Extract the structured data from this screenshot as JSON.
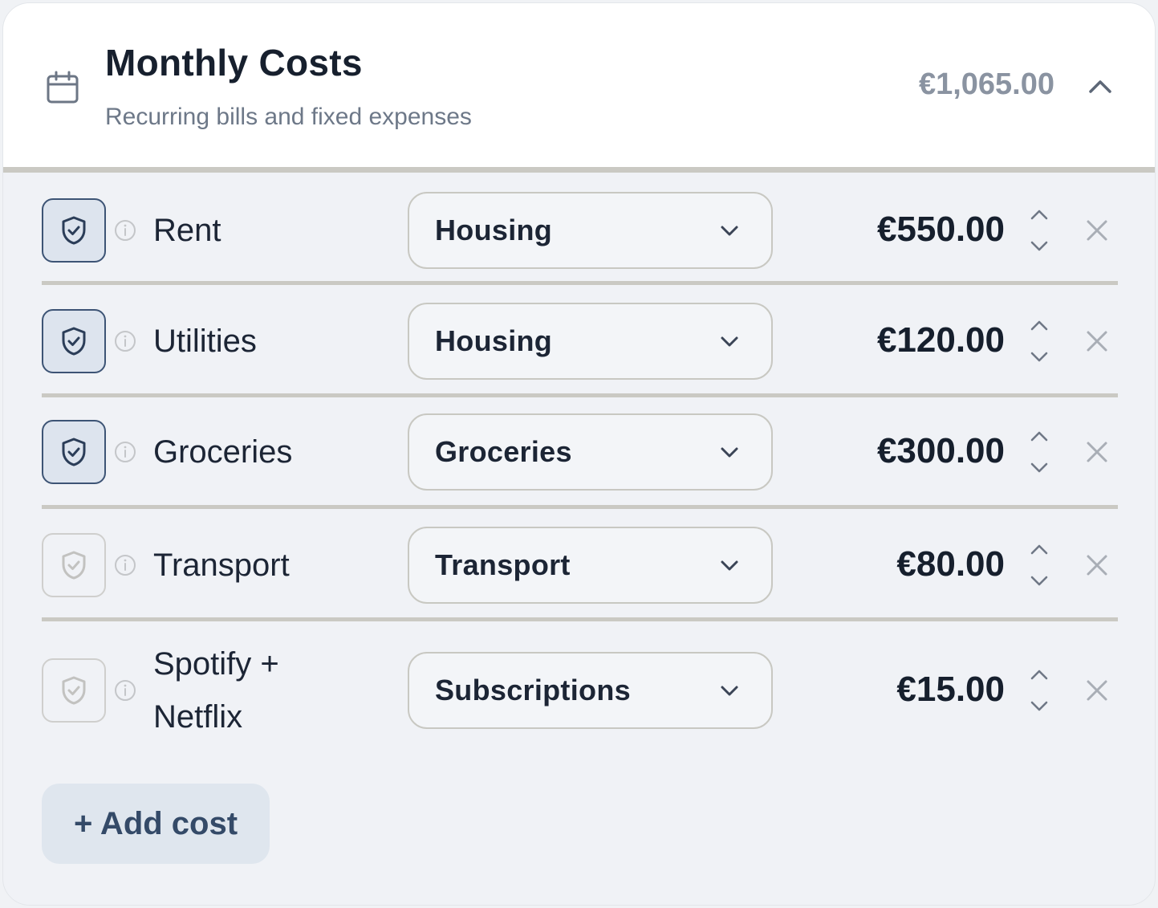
{
  "header": {
    "title": "Monthly Costs",
    "subtitle": "Recurring bills and fixed expenses",
    "total": "€1,065.00"
  },
  "items": [
    {
      "name": "Rent",
      "category": "Housing",
      "amount": "€550.00",
      "protected": true
    },
    {
      "name": "Utilities",
      "category": "Housing",
      "amount": "€120.00",
      "protected": true
    },
    {
      "name": "Groceries",
      "category": "Groceries",
      "amount": "€300.00",
      "protected": true
    },
    {
      "name": "Transport",
      "category": "Transport",
      "amount": "€80.00",
      "protected": false
    },
    {
      "name": "Spotify + Netflix",
      "category": "Subscriptions",
      "amount": "€15.00",
      "protected": false
    }
  ],
  "add_label": "+ Add cost",
  "icons": {
    "header": "calendar-icon",
    "collapse": "chevron-up-icon",
    "protect": "shield-check-icon",
    "info": "info-icon",
    "dropdown": "chevron-down-icon",
    "remove": "close-icon"
  },
  "colors": {
    "protected_border": "#3d5475",
    "protected_fill": "#dde4ee",
    "add_button_bg": "#dfe6ee",
    "add_button_text": "#344a68"
  }
}
